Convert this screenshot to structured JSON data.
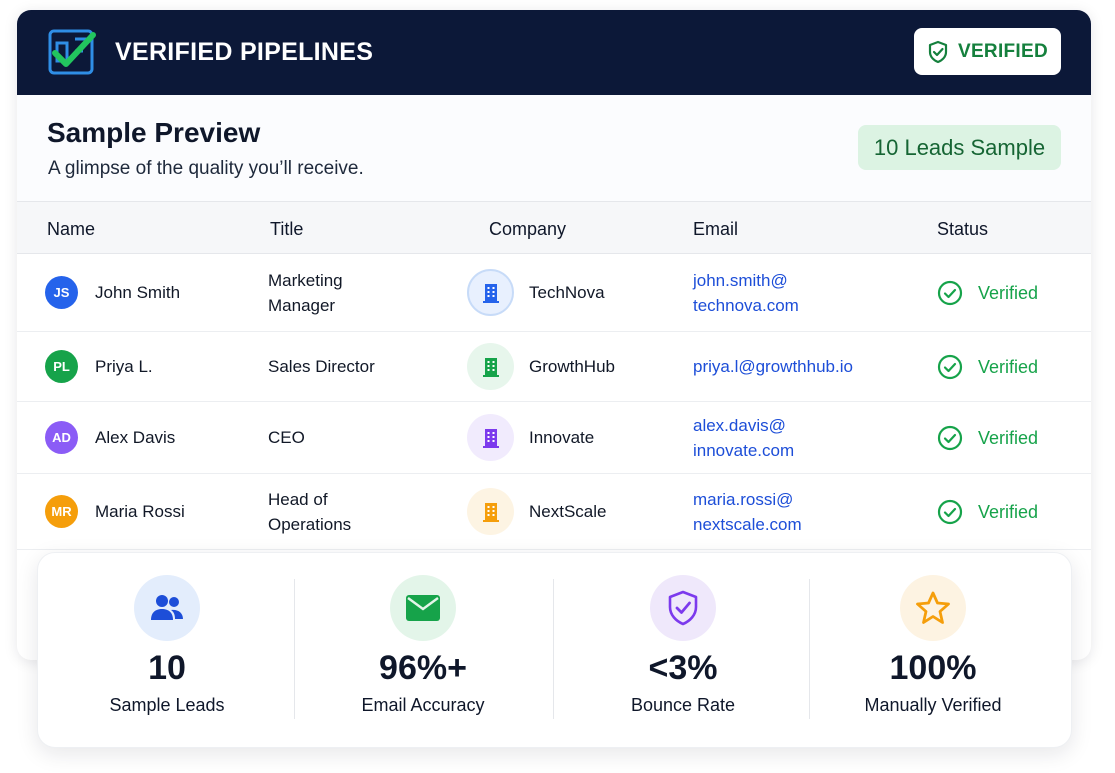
{
  "header": {
    "brand": "VERIFIED PIPELINES",
    "badge_label": "VERIFIED"
  },
  "preview": {
    "title": "Sample Preview",
    "subtitle": "A glimpse of the quality you’ll receive.",
    "sample_badge": "10 Leads Sample"
  },
  "table": {
    "columns": [
      "Name",
      "Title",
      "Company",
      "Email",
      "Status"
    ],
    "rows": [
      {
        "initials": "JS",
        "avatar_color": "#2563eb",
        "name": "John Smith",
        "title_l1": "Marketing",
        "title_l2": "Manager",
        "company": "TechNova",
        "company_icon": "building-icon",
        "icon_color": "#2563eb",
        "icon_bg": "#e8f0fe",
        "email_l1": "john.smith@",
        "email_l2": "technova.com",
        "status": "Verified"
      },
      {
        "initials": "PL",
        "avatar_color": "#16a34a",
        "name": "Priya L.",
        "title_l1": "Sales Director",
        "title_l2": "",
        "company": "GrowthHub",
        "company_icon": "building-icon",
        "icon_color": "#16a34a",
        "icon_bg": "#e7f6ec",
        "email_l1": "priya.l@growthhub.io",
        "email_l2": "",
        "status": "Verified"
      },
      {
        "initials": "AD",
        "avatar_color": "#8b5cf6",
        "name": "Alex Davis",
        "title_l1": "CEO",
        "title_l2": "",
        "company": "Innovate",
        "company_icon": "building-icon",
        "icon_color": "#7c3aed",
        "icon_bg": "#f1ebfd",
        "email_l1": "alex.davis@",
        "email_l2": "innovate.com",
        "status": "Verified"
      },
      {
        "initials": "MR",
        "avatar_color": "#f59e0b",
        "name": "Maria Rossi",
        "title_l1": "Head of",
        "title_l2": "Operations",
        "company": "NextScale",
        "company_icon": "building-icon",
        "icon_color": "#f59e0b",
        "icon_bg": "#fdf4e3",
        "email_l1": "maria.rossi@",
        "email_l2": "nextscale.com",
        "status": "Verified"
      }
    ]
  },
  "stats": [
    {
      "icon": "users-icon",
      "value": "10",
      "label": "Sample Leads",
      "bg": "#e3edfc",
      "color": "#1d4ed8"
    },
    {
      "icon": "envelope-icon",
      "value": "96%+",
      "label": "Email Accuracy",
      "bg": "#e3f5e9",
      "color": "#16a34a"
    },
    {
      "icon": "shield-check-icon",
      "value": "<3%",
      "label": "Bounce Rate",
      "bg": "#efe8fb",
      "color": "#7c3aed"
    },
    {
      "icon": "star-icon",
      "value": "100%",
      "label": "Manually Verified",
      "bg": "#fdf3e2",
      "color": "#f59e0b"
    }
  ],
  "colors": {
    "navy": "#0c1838",
    "verified_green": "#16a34a",
    "link_blue": "#1d4ed8"
  }
}
